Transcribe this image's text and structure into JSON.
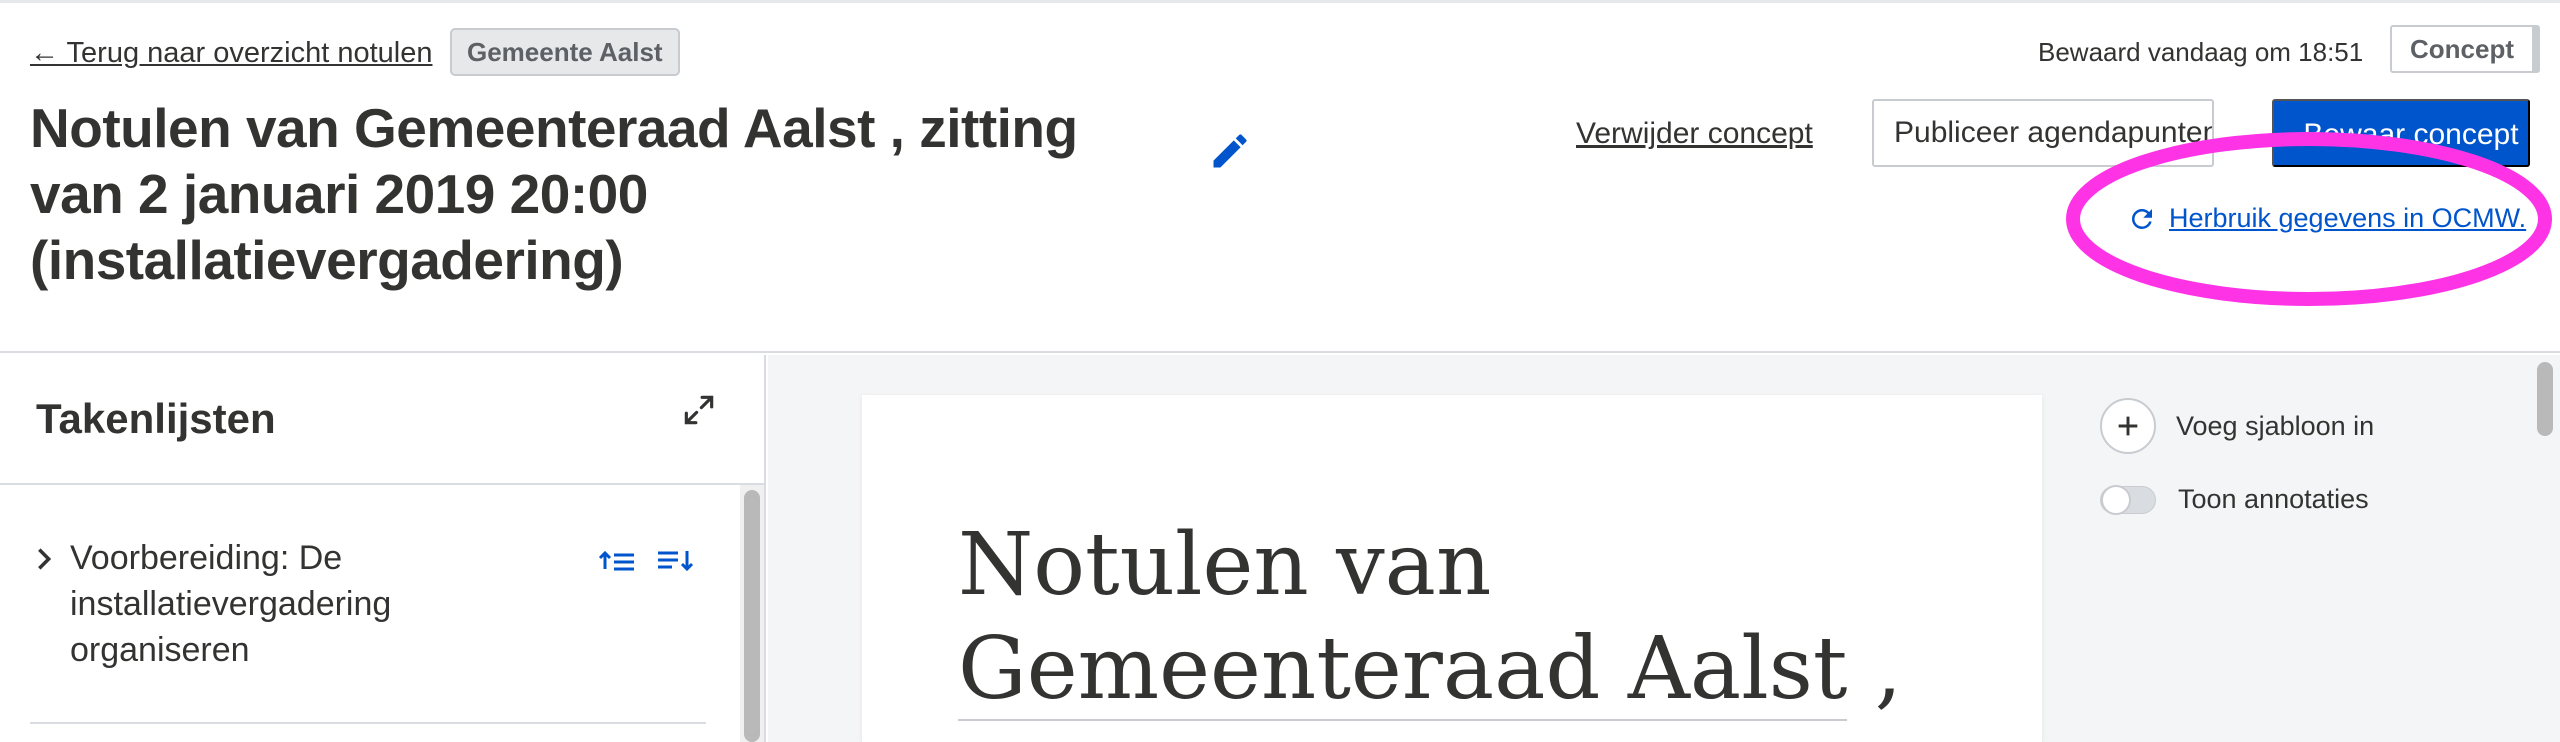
{
  "header": {
    "back_link": "← Terug naar overzicht notulen",
    "organization_badge": "Gemeente Aalst",
    "title": "Notulen van Gemeenteraad Aalst , zitting van 2 januari 2019 20:00 (installatievergadering)",
    "saved_status": "Bewaard vandaag om 18:51",
    "status_pill": "Concept",
    "delete_link": "Verwijder concept",
    "publish_agenda_button": "Publiceer agendapunten",
    "save_button": "Bewaar concept",
    "reuse_link": "Herbruik gegevens in OCMW."
  },
  "left_panel": {
    "title": "Takenlijsten",
    "tasks": [
      {
        "label": "Voorbereiding: De installatievergadering organiseren"
      }
    ]
  },
  "editor": {
    "heading_line1": "Notulen van",
    "heading_line2": "Gemeenteraad Aalst",
    "heading_tail": ","
  },
  "sidebar": {
    "insert_template_label": "Voeg sjabloon in",
    "annotations_label": "Toon annotaties",
    "annotations_on": false
  },
  "colors": {
    "primary": "#0055cc",
    "highlight": "#ff33e6",
    "text": "#333332",
    "border": "#c8ccd0"
  },
  "icons": [
    "pencil-icon",
    "refresh-icon",
    "expand-icon",
    "chevron-right-icon",
    "sort-ascending-icon",
    "sort-descending-icon",
    "plus-icon"
  ]
}
